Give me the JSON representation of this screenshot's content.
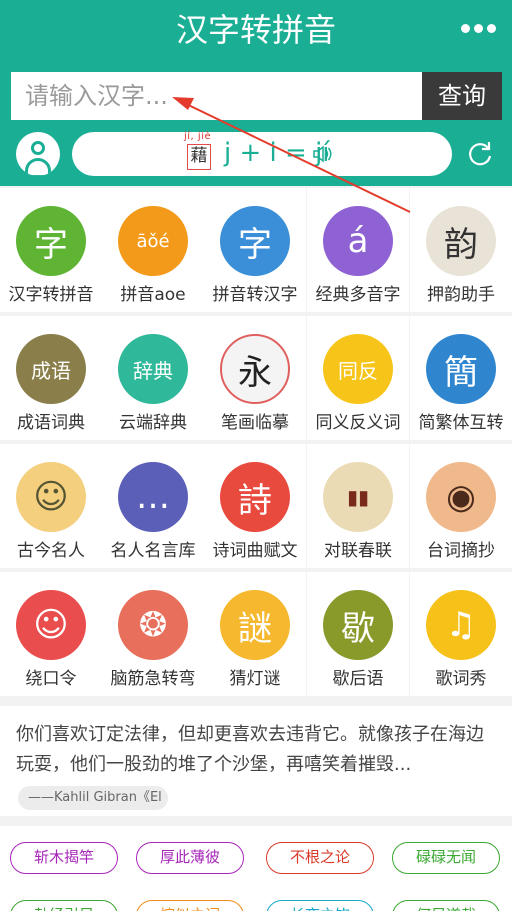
{
  "header": {
    "title": "汉字转拼音",
    "menu_icon": "more-dots-icon"
  },
  "search": {
    "placeholder": "请输入汉字...",
    "button": "查询"
  },
  "banner": {
    "pinyin_small": "jí, jiè",
    "char": "藉",
    "formula": "j + i = jí"
  },
  "grid": [
    {
      "label": "汉字转拼音",
      "icon": "hanzi-to-pinyin-icon",
      "color": "#5fb434"
    },
    {
      "label": "拼音aoe",
      "icon": "pinyin-aoe-icon",
      "color": "#f39a1a"
    },
    {
      "label": "拼音转汉字",
      "icon": "pinyin-to-hanzi-icon",
      "color": "#3b8fd9"
    },
    {
      "label": "经典多音字",
      "icon": "polyphone-icon",
      "color": "#8f62d4"
    },
    {
      "label": "押韵助手",
      "icon": "rhyme-icon",
      "color": "#e8e3d6"
    },
    {
      "label": "成语词典",
      "icon": "idiom-dictionary-icon",
      "color": "#8a7f4a"
    },
    {
      "label": "云端辞典",
      "icon": "cloud-dictionary-icon",
      "color": "#2fb89a"
    },
    {
      "label": "笔画临摹",
      "icon": "stroke-practice-icon",
      "color": "#f4f4f4"
    },
    {
      "label": "同义反义词",
      "icon": "synonym-antonym-icon",
      "color": "#f7c51a"
    },
    {
      "label": "简繁体互转",
      "icon": "simplified-traditional-icon",
      "color": "#2f86cf"
    },
    {
      "label": "古今名人",
      "icon": "famous-people-icon",
      "color": "#f4cf7e"
    },
    {
      "label": "名人名言库",
      "icon": "famous-quotes-icon",
      "color": "#5b5fb8"
    },
    {
      "label": "诗词曲赋文",
      "icon": "poetry-icon",
      "color": "#e84a3e"
    },
    {
      "label": "对联春联",
      "icon": "couplet-icon",
      "color": "#eadbb4"
    },
    {
      "label": "台词摘抄",
      "icon": "film-lines-icon",
      "color": "#f0b98c"
    },
    {
      "label": "绕口令",
      "icon": "tongue-twister-icon",
      "color": "#ea4d4d"
    },
    {
      "label": "脑筋急转弯",
      "icon": "brain-teaser-icon",
      "color": "#e76f5c"
    },
    {
      "label": "猜灯谜",
      "icon": "lantern-riddle-icon",
      "color": "#f5b82e"
    },
    {
      "label": "歇后语",
      "icon": "xiehouyu-icon",
      "color": "#8a9a2a"
    },
    {
      "label": "歌词秀",
      "icon": "lyrics-icon",
      "color": "#f6c219"
    }
  ],
  "quote": {
    "text": "你们喜欢订定法律，但却更喜欢去违背它。就像孩子在海边玩耍，他们一股劲的堆了个沙堡，再嘻笑着摧毁...",
    "author": "——Kahlil Gibran《El"
  },
  "tags": [
    {
      "label": "斩木揭竿",
      "color": "#a626b8"
    },
    {
      "label": "厚此薄彼",
      "color": "#a626b8"
    },
    {
      "label": "不根之论",
      "color": "#d93a2a"
    },
    {
      "label": "碌碌无闻",
      "color": "#3aa832"
    },
    {
      "label": "勃经引另",
      "color": "#3aa832"
    },
    {
      "label": "惋似之词",
      "color": "#f08c1a"
    },
    {
      "label": "长夜之饮",
      "color": "#1aa8c8"
    },
    {
      "label": "何足道哉",
      "color": "#3aa832"
    }
  ]
}
